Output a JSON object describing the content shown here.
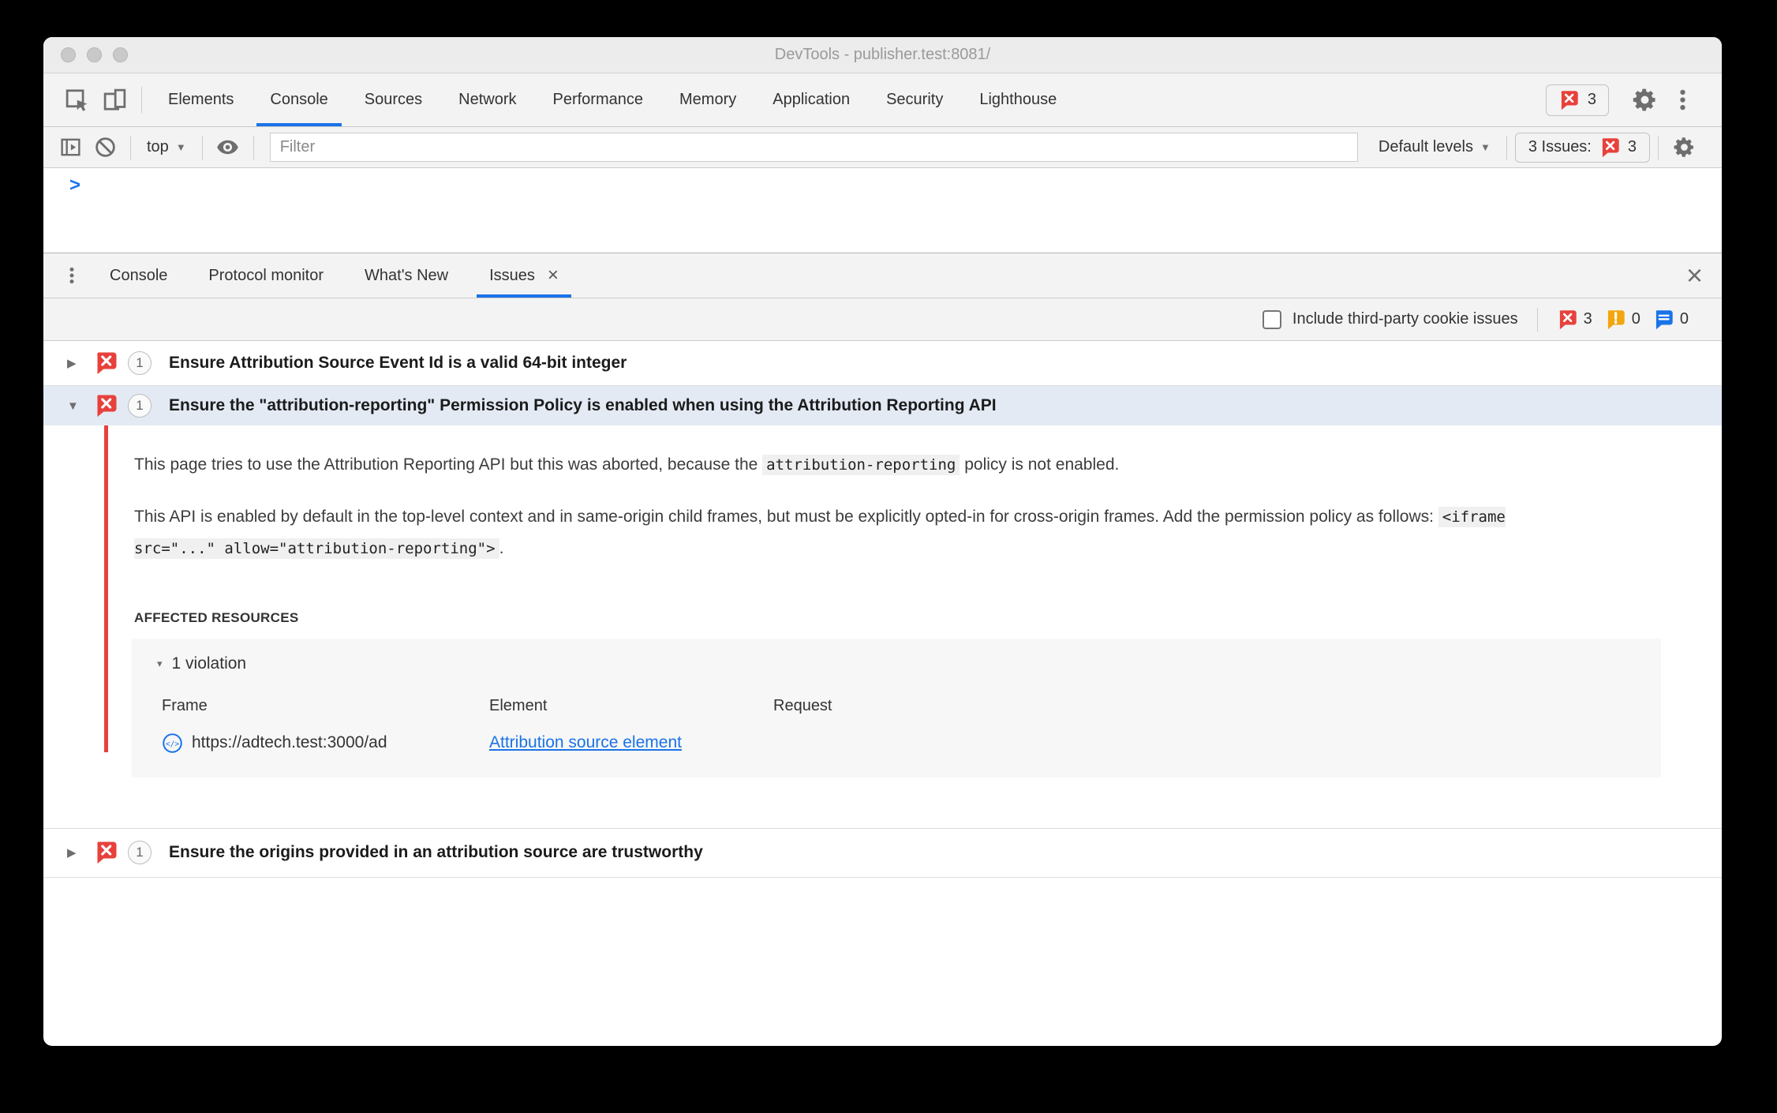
{
  "colors": {
    "accent_blue": "#1a73e8",
    "error_red": "#e8413c",
    "warning_orange": "#f2a60d",
    "message_blue": "#1a73e8",
    "toolbar_bg": "#f3f3f3",
    "selected_issue_bg": "#e3eaf4"
  },
  "window": {
    "title": "DevTools - publisher.test:8081/"
  },
  "main_toolbar": {
    "tabs": [
      "Elements",
      "Console",
      "Sources",
      "Network",
      "Performance",
      "Memory",
      "Application",
      "Security",
      "Lighthouse"
    ],
    "active_tab": "Console",
    "error_count": "3"
  },
  "console_toolbar": {
    "context": "top",
    "caret": "▼",
    "filter_placeholder": "Filter",
    "levels": "Default levels",
    "issues_text": "3 Issues:",
    "issues_count": "3"
  },
  "console": {
    "prompt": ">"
  },
  "drawer": {
    "tabs": [
      "Console",
      "Protocol monitor",
      "What's New",
      "Issues"
    ],
    "active_tab": "Issues",
    "tab_close": "×",
    "close": "×"
  },
  "issues_toolbar": {
    "checkbox_label": "Include third-party cookie issues",
    "error_count": "3",
    "warning_count": "0",
    "message_count": "0"
  },
  "glyphs": {
    "tri_right": "▶",
    "tri_down": "▼",
    "tri_down_small": "▾"
  },
  "issues": [
    {
      "count": "1",
      "title": "Ensure Attribution Source Event Id is a valid 64-bit integer"
    },
    {
      "count": "1",
      "title": "Ensure the \"attribution-reporting\" Permission Policy is enabled when using the Attribution Reporting API",
      "description_1": "This page tries to use the Attribution Reporting API but this was aborted, because the ",
      "description_1_code": "attribution-reporting",
      "description_1_end": " policy is not enabled.",
      "description_2": "This API is enabled by default in the top-level context and in same-origin child frames, but must be explicitly opted-in for cross-origin frames. Add the permission policy as follows: ",
      "description_2_code": "<iframe src=\"...\" allow=\"attribution-reporting\">",
      "description_2_end": ".",
      "affected_resources_heading": "AFFECTED RESOURCES",
      "violation_label": "1 violation",
      "table_headers": [
        "Frame",
        "Element",
        "Request"
      ],
      "row": {
        "frame_url": "https://adtech.test:3000/ad",
        "element_link": "Attribution source element",
        "request": ""
      }
    },
    {
      "count": "1",
      "title": "Ensure the origins provided in an attribution source are trustworthy"
    }
  ]
}
